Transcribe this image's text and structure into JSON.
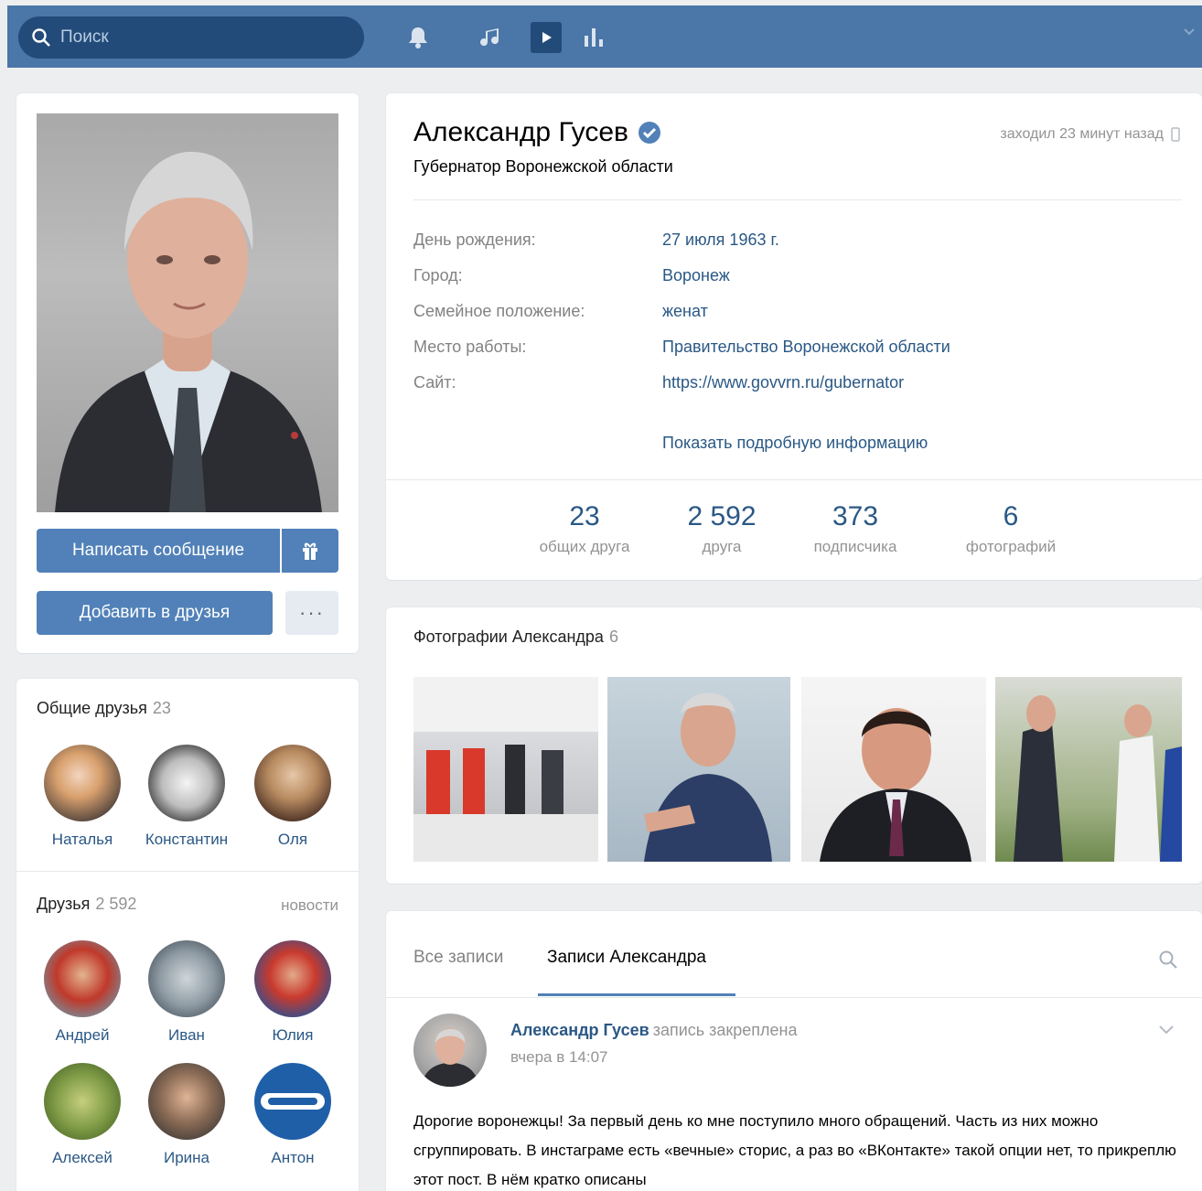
{
  "topbar": {
    "search_placeholder": "Поиск",
    "icons": [
      "bell-icon",
      "music-icon",
      "video-icon",
      "stats-icon"
    ]
  },
  "profile": {
    "name": "Александр Гусев",
    "status": "Губернатор Воронежской области",
    "last_seen": "заходил 23 минут назад",
    "info": [
      {
        "key": "День рождения:",
        "value": "27 июля 1963 г."
      },
      {
        "key": "Город:",
        "value": "Воронеж"
      },
      {
        "key": "Семейное положение:",
        "value": "женат"
      },
      {
        "key": "Место работы:",
        "value": "Правительство Воронежской области"
      },
      {
        "key": "Сайт:",
        "value": "https://www.govvrn.ru/gubernator"
      }
    ],
    "more_info": "Показать подробную информацию",
    "counters": [
      {
        "num": "23",
        "label": "общих друга"
      },
      {
        "num": "2 592",
        "label": "друга"
      },
      {
        "num": "373",
        "label": "подписчика"
      },
      {
        "num": "6",
        "label": "фотографий"
      }
    ]
  },
  "actions": {
    "message": "Написать сообщение",
    "add_friend": "Добавить в друзья",
    "more": "···"
  },
  "mutual_friends": {
    "title": "Общие друзья",
    "count": "23",
    "items": [
      "Наталья",
      "Константин",
      "Оля"
    ]
  },
  "friends": {
    "title": "Друзья",
    "count": "2 592",
    "link": "новости",
    "items": [
      "Андрей",
      "Иван",
      "Юлия",
      "Алексей",
      "Ирина",
      "Антон"
    ]
  },
  "photos": {
    "title": "Фотографии Александра",
    "count": "6"
  },
  "wall": {
    "tabs": [
      "Все записи",
      "Записи Александра"
    ],
    "post": {
      "author": "Александр Гусев",
      "pinned": "запись закреплена",
      "time": "вчера в 14:07",
      "text": "Дорогие воронежцы! За первый день ко мне поступило много обращений. Часть из них можно сгруппировать. В инстаграме есть «вечные» сторис, а раз во «ВКонтакте» такой опции нет, то прикреплю этот пост. В нём кратко описаны"
    }
  },
  "colors": {
    "header": "#4a76a8",
    "accent": "#5181b8",
    "link": "#2a5885",
    "muted": "#939393"
  }
}
